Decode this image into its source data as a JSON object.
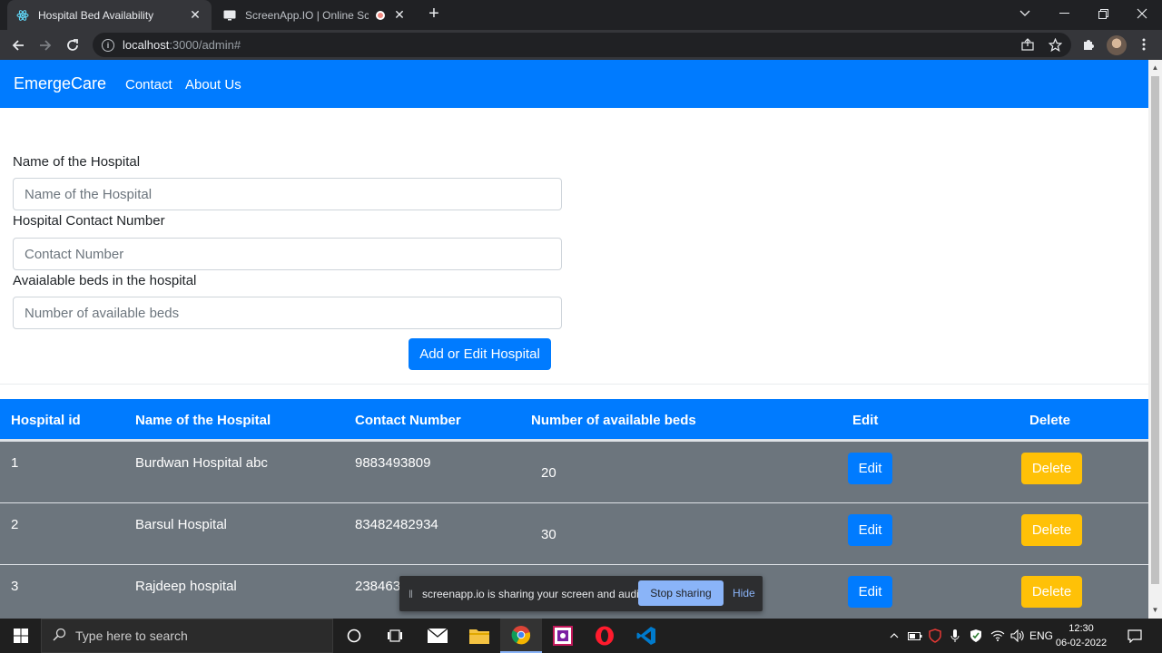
{
  "browser": {
    "tabs": [
      {
        "title": "Hospital Bed Availability",
        "active": true
      },
      {
        "title": "ScreenApp.IO | Online Screen",
        "active": false
      }
    ],
    "url_host": "localhost",
    "url_path": ":3000/admin#"
  },
  "navbar": {
    "brand": "EmergeCare",
    "links": [
      "Contact",
      "About Us"
    ]
  },
  "form": {
    "name_label": "Name of the Hospital",
    "name_placeholder": "Name of the Hospital",
    "contact_label": "Hospital Contact Number",
    "contact_placeholder": "Contact Number",
    "beds_label": "Avaialable beds in the hospital",
    "beds_placeholder": "Number of available beds",
    "submit_label": "Add or Edit Hospital"
  },
  "table": {
    "headers": [
      "Hospital id",
      "Name of the Hospital",
      "Contact Number",
      "Number of available beds",
      "Edit",
      "Delete"
    ],
    "rows": [
      {
        "id": "1",
        "name": "Burdwan Hospital abc",
        "contact": "9883493809",
        "beds": "20"
      },
      {
        "id": "2",
        "name": "Barsul Hospital",
        "contact": "83482482934",
        "beds": "30"
      },
      {
        "id": "3",
        "name": "Rajdeep hospital",
        "contact": "238463",
        "beds": ""
      }
    ],
    "edit_label": "Edit",
    "delete_label": "Delete"
  },
  "share_banner": {
    "message": "screenapp.io is sharing your screen and audio.",
    "stop_label": "Stop sharing",
    "hide_label": "Hide"
  },
  "taskbar": {
    "search_placeholder": "Type here to search",
    "language": "ENG",
    "time": "12:30",
    "date": "06-02-2022"
  },
  "colors": {
    "primary": "#007bff",
    "secondary": "#6c757d",
    "warning": "#ffc107"
  }
}
